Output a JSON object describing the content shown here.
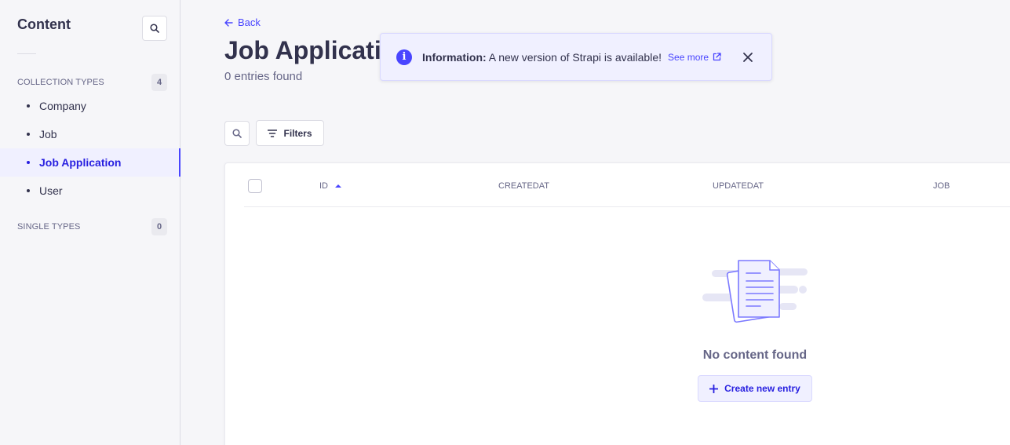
{
  "sidebar": {
    "title": "Content",
    "collection_types": {
      "label": "COLLECTION TYPES",
      "count": "4",
      "items": [
        {
          "label": "Company"
        },
        {
          "label": "Job"
        },
        {
          "label": "Job Application"
        },
        {
          "label": "User"
        }
      ]
    },
    "single_types": {
      "label": "SINGLE TYPES",
      "count": "0"
    }
  },
  "header": {
    "back_label": "Back",
    "title": "Job Application",
    "entries_count": "0 entries found"
  },
  "alert": {
    "title": "Information:",
    "message": "A new version of Strapi is available!",
    "link_label": "See more"
  },
  "toolbar": {
    "filters_label": "Filters"
  },
  "table": {
    "columns": [
      "ID",
      "CREATEDAT",
      "UPDATEDAT",
      "JOB"
    ],
    "empty_text": "No content found",
    "create_label": "Create new entry"
  },
  "colors": {
    "accent": "#4945ff",
    "accent_dark": "#271fe0",
    "accent_light": "#f0f0ff"
  }
}
